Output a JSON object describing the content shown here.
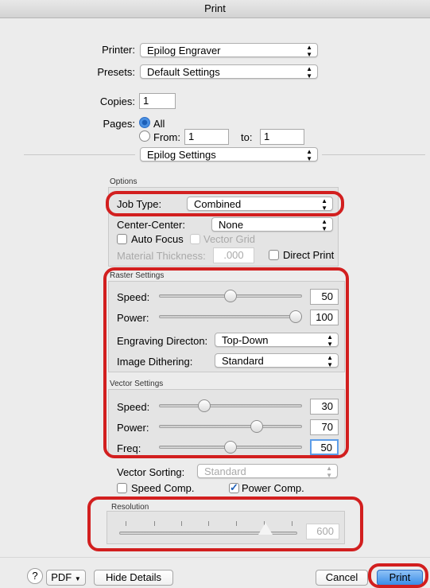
{
  "window": {
    "title": "Print"
  },
  "printer": {
    "label": "Printer:",
    "value": "Epilog Engraver"
  },
  "presets": {
    "label": "Presets:",
    "value": "Default Settings"
  },
  "copies": {
    "label": "Copies:",
    "value": "1"
  },
  "pages": {
    "label": "Pages:",
    "all_label": "All",
    "from_label": "From:",
    "from_value": "1",
    "to_label": "to:",
    "to_value": "1",
    "selected": "All"
  },
  "panel_select": {
    "value": "Epilog Settings"
  },
  "options": {
    "title": "Options",
    "job_type": {
      "label": "Job Type:",
      "value": "Combined"
    },
    "center": {
      "label": "Center-Center:",
      "value": "None"
    },
    "auto_focus": {
      "label": "Auto Focus",
      "checked": false
    },
    "vector_grid": {
      "label": "Vector Grid",
      "checked": false,
      "enabled": false
    },
    "material_thickness": {
      "label": "Material Thickness:",
      "value": ".000",
      "enabled": false
    },
    "direct_print": {
      "label": "Direct Print",
      "checked": false
    }
  },
  "raster": {
    "title": "Raster Settings",
    "speed": {
      "label": "Speed:",
      "value": "50",
      "level": 0.5
    },
    "power": {
      "label": "Power:",
      "value": "100",
      "level": 1.0
    },
    "engraving_direction": {
      "label": "Engraving Directon:",
      "value": "Top-Down"
    },
    "image_dithering": {
      "label": "Image Dithering:",
      "value": "Standard"
    }
  },
  "vector": {
    "title": "Vector Settings",
    "speed": {
      "label": "Speed:",
      "value": "30",
      "level": 0.3
    },
    "power": {
      "label": "Power:",
      "value": "70",
      "level": 0.7
    },
    "freq": {
      "label": "Freq:",
      "value": "50",
      "level": 0.5
    },
    "sorting": {
      "label": "Vector Sorting:",
      "value": "Standard",
      "enabled": false
    },
    "speed_comp": {
      "label": "Speed Comp.",
      "checked": false
    },
    "power_comp": {
      "label": "Power Comp.",
      "checked": true
    }
  },
  "resolution": {
    "title": "Resolution",
    "value": "600"
  },
  "footer": {
    "help": "?",
    "pdf": "PDF",
    "hide_details": "Hide Details",
    "cancel": "Cancel",
    "print": "Print"
  },
  "colors": {
    "annotation": "#d21f1f",
    "accent": "#3a8ce8"
  }
}
